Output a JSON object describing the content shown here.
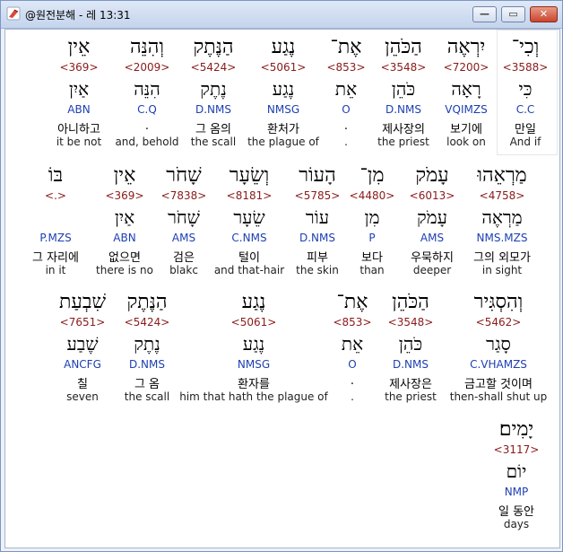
{
  "window": {
    "title": "@원전분해 - 레 13:31",
    "minimize_glyph": "—",
    "maximize_glyph": "▭",
    "close_glyph": "✕"
  },
  "rows": [
    [
      {
        "hebrew": "וְכִי־",
        "ref": "<3588>",
        "lemma": "כִּי",
        "morph": "C.C",
        "kor": "만일",
        "eng": "And if"
      },
      {
        "hebrew": "יִרְאֶה",
        "ref": "<7200>",
        "lemma": "רָאָה",
        "morph": "VQIMZS",
        "kor": "보기에",
        "eng": "look on"
      },
      {
        "hebrew": "הַכֹּהֵן",
        "ref": "<3548>",
        "lemma": "כֹּהֵן",
        "morph": "D.NMS",
        "kor": "제사장의",
        "eng": "the priest"
      },
      {
        "hebrew": "אֶת־",
        "ref": "<853>",
        "lemma": "אֵת",
        "morph": "O",
        "kor": ".",
        "eng": "."
      },
      {
        "hebrew": "נֶגַע",
        "ref": "<5061>",
        "lemma": "נֶגַע",
        "morph": "NMSG",
        "kor": "환처가",
        "eng": "the plague of"
      },
      {
        "hebrew": "הַנֶּתֶק",
        "ref": "<5424>",
        "lemma": "נֶתֶק",
        "morph": "D.NMS",
        "kor": "그 옴의",
        "eng": "the scall"
      },
      {
        "hebrew": "וְהִנֵּה",
        "ref": "<2009>",
        "lemma": "הִנֵּה",
        "morph": "C.Q",
        "kor": ".",
        "eng": "and, behold"
      },
      {
        "hebrew": "אֵין",
        "ref": "<369>",
        "lemma": "אַיִן",
        "morph": "ABN",
        "kor": "아니하고",
        "eng": "it be not"
      }
    ],
    [
      {
        "hebrew": "מַרְאֵהוּ",
        "ref": "<4758>",
        "lemma": "מַרְאֶה",
        "morph": "NMS.MZS",
        "kor": "그의 외모가",
        "eng": "in sight"
      },
      {
        "hebrew": "עָמֹק",
        "ref": "<6013>",
        "lemma": "עָמֹק",
        "morph": "AMS",
        "kor": "우묵하지",
        "eng": "deeper"
      },
      {
        "hebrew": "מִן־",
        "ref": "<4480>",
        "lemma": "מִן",
        "morph": "P",
        "kor": "보다",
        "eng": "than"
      },
      {
        "hebrew": "הָעוֹר",
        "ref": "<5785>",
        "lemma": "עוֹר",
        "morph": "D.NMS",
        "kor": "피부",
        "eng": "the skin"
      },
      {
        "hebrew": "וְשֵׂעָר",
        "ref": "<8181>",
        "lemma": "שֵׂעָר",
        "morph": "C.NMS",
        "kor": "털이",
        "eng": "and that-hair"
      },
      {
        "hebrew": "שָׁחֹר",
        "ref": "<7838>",
        "lemma": "שָׁחֹר",
        "morph": "AMS",
        "kor": "검은",
        "eng": "blakc"
      },
      {
        "hebrew": "אֵין",
        "ref": "<369>",
        "lemma": "אַיִן",
        "morph": "ABN",
        "kor": "없으면",
        "eng": "there is no"
      },
      {
        "hebrew": "בּוֹ",
        "ref": "<.>",
        "lemma": "",
        "morph": "P.MZS",
        "kor": "그 자리에",
        "eng": "in it"
      }
    ],
    [
      {
        "hebrew": "וְהִסְגִּיר",
        "ref": "<5462>",
        "lemma": "סָגַר",
        "morph": "C.VHAMZS",
        "kor": "금고할 것이며",
        "eng": "then-shall shut up"
      },
      {
        "hebrew": "הַכֹּהֵן",
        "ref": "<3548>",
        "lemma": "כֹּהֵן",
        "morph": "D.NMS",
        "kor": "제사장은",
        "eng": "the priest"
      },
      {
        "hebrew": "אֶת־",
        "ref": "<853>",
        "lemma": "אֵת",
        "morph": "O",
        "kor": ".",
        "eng": "."
      },
      {
        "hebrew": "נֶגַע",
        "ref": "<5061>",
        "lemma": "נֶגַע",
        "morph": "NMSG",
        "kor": "환자를",
        "eng": "him that hath the plague of"
      },
      {
        "hebrew": "הַנֶּתֶק",
        "ref": "<5424>",
        "lemma": "נֶתֶק",
        "morph": "D.NMS",
        "kor": "그 옴",
        "eng": "the scall"
      },
      {
        "hebrew": "שִׁבְעַת",
        "ref": "<7651>",
        "lemma": "שֶׁבַע",
        "morph": "ANCFG",
        "kor": "칠",
        "eng": "seven"
      }
    ],
    [
      {
        "hebrew": "יָמִים׃",
        "ref": "<3117>",
        "lemma": "יוֹם",
        "morph": "NMP",
        "kor": "일 동안",
        "eng": "days"
      }
    ]
  ]
}
